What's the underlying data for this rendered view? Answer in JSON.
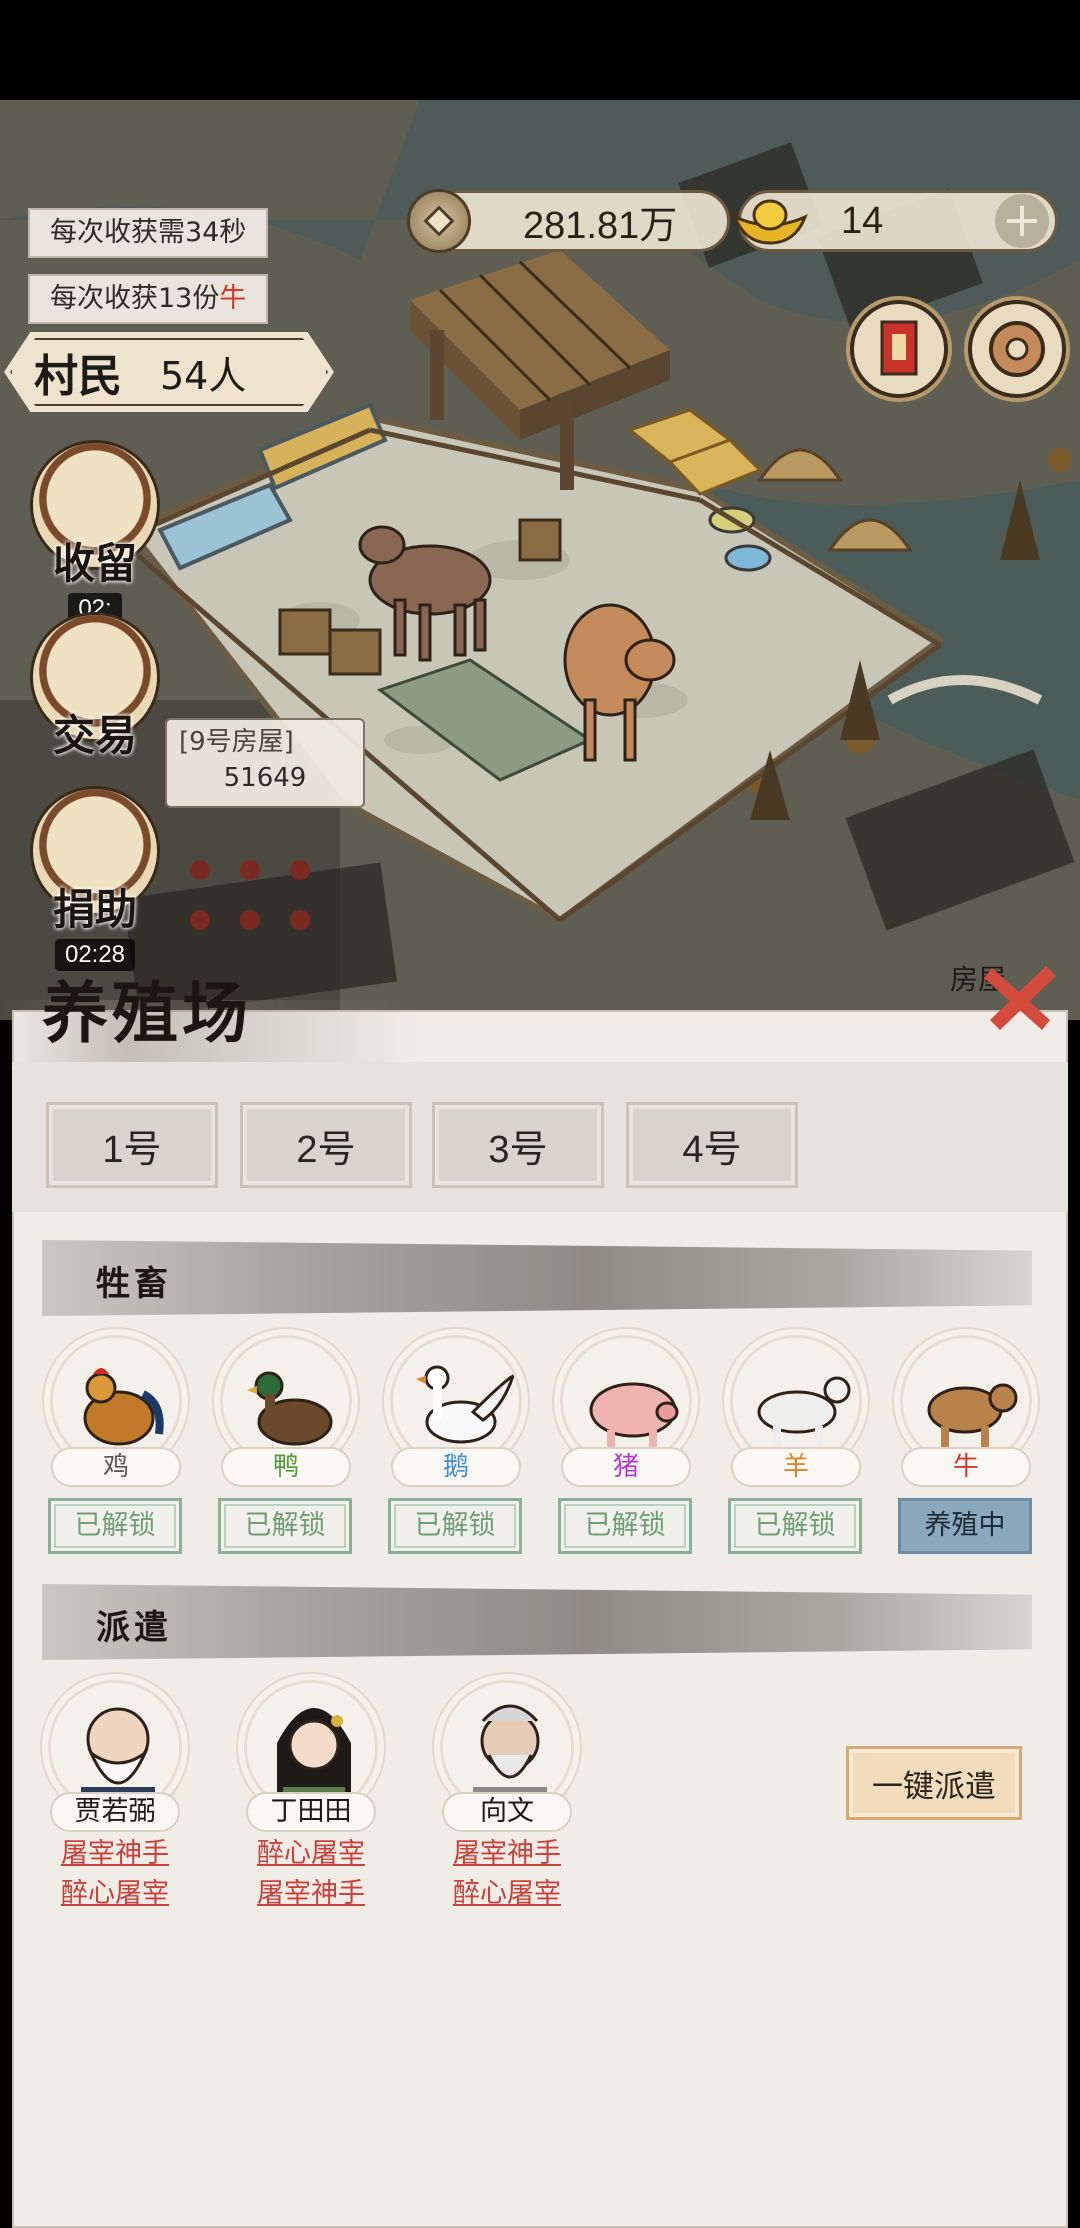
{
  "hud": {
    "coins": "281.81万",
    "gold": "14",
    "plus_label": "+"
  },
  "tips": {
    "harvest_time": "每次收获需34秒",
    "harvest_amount_prefix": "每次收获13份",
    "harvest_amount_item": "牛"
  },
  "villagers": {
    "label": "村民",
    "count": "54人"
  },
  "side_buttons": [
    {
      "label": "收留",
      "time": "02:"
    },
    {
      "label": "交易",
      "time": ""
    },
    {
      "label": "捐助",
      "time": "02:28"
    }
  ],
  "speech": {
    "text": "[9号房屋]",
    "number": "51649"
  },
  "map": {
    "house_label": "房屋"
  },
  "panel": {
    "title": "养殖场",
    "tabs": [
      {
        "label": "1号",
        "active": true
      },
      {
        "label": "2号",
        "active": false
      },
      {
        "label": "3号",
        "active": false
      },
      {
        "label": "4号",
        "active": false
      }
    ],
    "livestock_title": "牲畜",
    "animals": [
      {
        "name": "鸡",
        "color": "#5b5650",
        "status": "已解锁"
      },
      {
        "name": "鸭",
        "color": "#4f9a3a",
        "status": "已解锁"
      },
      {
        "name": "鹅",
        "color": "#3d8fd6",
        "status": "已解锁"
      },
      {
        "name": "猪",
        "color": "#b33bd1",
        "status": "已解锁"
      },
      {
        "name": "羊",
        "color": "#e0862a",
        "status": "已解锁"
      },
      {
        "name": "牛",
        "color": "#d6392b",
        "status": "养殖中"
      }
    ],
    "dispatch_title": "派遣",
    "people": [
      {
        "name": "贾若弼",
        "skills": [
          "屠宰神手",
          "醉心屠宰"
        ]
      },
      {
        "name": "丁田田",
        "skills": [
          "醉心屠宰",
          "屠宰神手"
        ]
      },
      {
        "name": "向文",
        "skills": [
          "屠宰神手",
          "醉心屠宰"
        ]
      }
    ],
    "dispatch_button": "一键派遣"
  },
  "colors": {
    "accent_red": "#d6392b",
    "active_tab": "#f1dcbc",
    "unlocked_green": "#6f9e76",
    "breeding_blue": "#8aa9bf"
  }
}
